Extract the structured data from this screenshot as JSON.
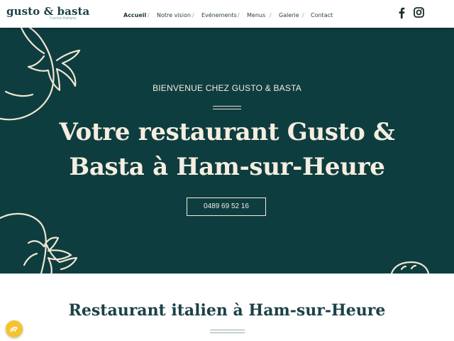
{
  "header": {
    "logo_main": "gusto & basta",
    "logo_sub": "Cucina italiana",
    "nav": [
      {
        "label": "Accueil",
        "active": true
      },
      {
        "label": "Notre vision"
      },
      {
        "label": "Evénements"
      },
      {
        "label": "Menus"
      },
      {
        "label": "Galerie"
      },
      {
        "label": "Contact"
      }
    ],
    "separator": "/",
    "social": [
      "facebook-icon",
      "instagram-icon"
    ]
  },
  "hero": {
    "welcome": "BIENVENUE CHEZ GUSTO & BASTA",
    "title_line1": "Votre restaurant Gusto &",
    "title_line2": "Basta à Ham-sur-Heure",
    "phone": "0489 69 52 16"
  },
  "section": {
    "title": "Restaurant italien à Ham-sur-Heure"
  },
  "colors": {
    "hero_bg": "#0e3d3f",
    "cream": "#f5eee0",
    "brand": "#1c4147",
    "cookie": "#f4c430"
  },
  "cookie_icon": "cookie-icon"
}
